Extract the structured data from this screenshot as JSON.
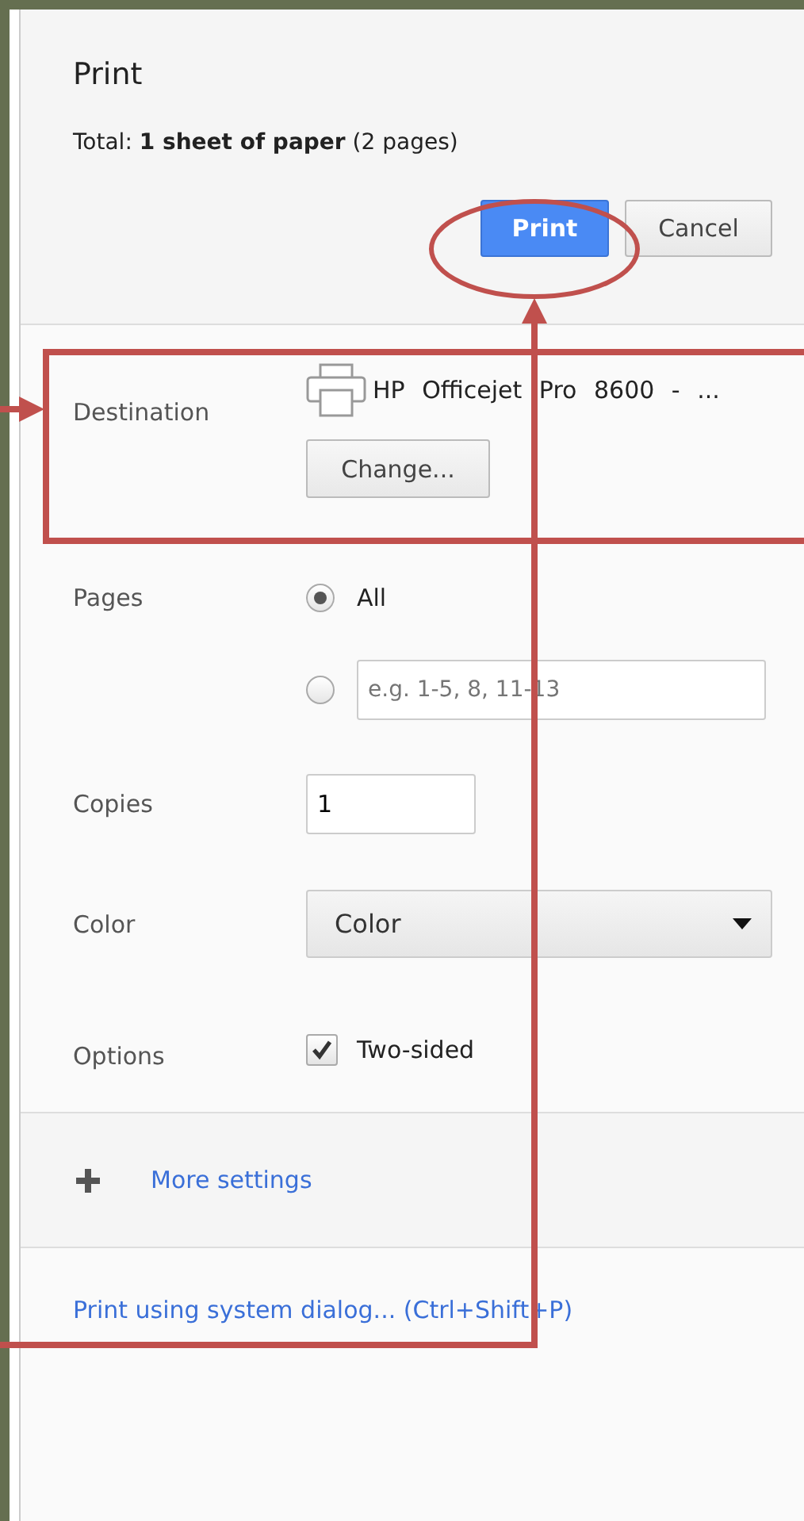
{
  "dialog": {
    "title": "Print",
    "total": "Total: **1 sheet of paper** (2 pages)"
  },
  "buttons": [
    {
      "label": "Print",
      "kind": "primary"
    },
    {
      "label": "Cancel",
      "kind": "default"
    }
  ],
  "destination": {
    "label": "Destination",
    "printer": "HP Officejet Pro 8600 - ...",
    "change_button": "Change..."
  },
  "pages": {
    "label": "Pages",
    "options": [
      {
        "kind": "all",
        "label": "All",
        "selected": true
      },
      {
        "kind": "range",
        "placeholder": "e.g. 1-5, 8, 11-13",
        "selected": false
      }
    ]
  },
  "copies": {
    "label": "Copies",
    "value": "1"
  },
  "color": {
    "label": "Color",
    "value": "Color"
  },
  "options": {
    "label": "Options",
    "items": [
      {
        "label": "Two-sided",
        "checked": true
      }
    ]
  },
  "more_settings": "More settings",
  "system_dialog_link": "Print using system dialog... (Ctrl+Shift+P)"
}
